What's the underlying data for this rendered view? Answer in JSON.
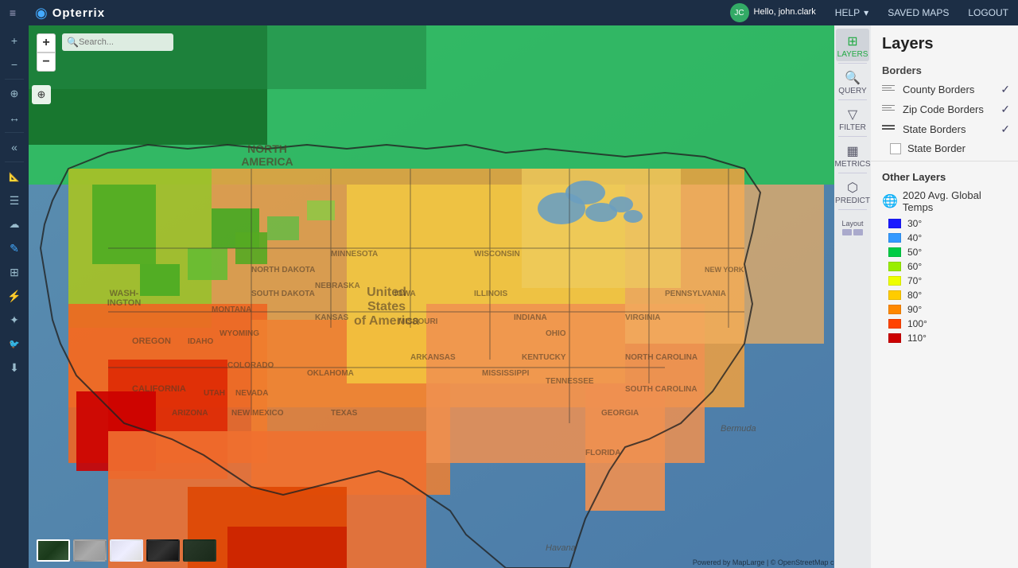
{
  "navbar": {
    "expand_icon": "≡",
    "logo_icon": "◉",
    "logo_text": "Opterrix",
    "user": {
      "initials": "JC",
      "greeting": "Hello, john.clark",
      "help_label": "HELP",
      "help_chevron": "▾",
      "saved_maps_label": "SAVED MAPS",
      "logout_label": "LOGOUT"
    }
  },
  "left_toolbar": {
    "buttons": [
      {
        "name": "zoom-in",
        "icon": "+",
        "active": false
      },
      {
        "name": "zoom-out",
        "icon": "−",
        "active": false
      },
      {
        "name": "identify",
        "icon": "⊕",
        "active": false
      },
      {
        "name": "pan",
        "icon": "↔",
        "active": false
      },
      {
        "name": "previous",
        "icon": "«",
        "active": false
      },
      {
        "name": "ruler",
        "icon": "📏",
        "active": false
      },
      {
        "name": "layers-list",
        "icon": "☰",
        "active": false
      },
      {
        "name": "draw",
        "icon": "✏",
        "active": false
      },
      {
        "name": "sun",
        "icon": "☀",
        "active": false
      },
      {
        "name": "pencil",
        "icon": "✎",
        "active": true
      },
      {
        "name": "grid",
        "icon": "⊞",
        "active": false
      },
      {
        "name": "lightning",
        "icon": "⚡",
        "active": false
      },
      {
        "name": "star",
        "icon": "✦",
        "active": false
      },
      {
        "name": "twitter",
        "icon": "🐦",
        "active": false
      },
      {
        "name": "download",
        "icon": "⬇",
        "active": false
      }
    ]
  },
  "map": {
    "search_placeholder": "Search...",
    "attribution": "Powered by MapLarge | © OpenStreetMap contributors"
  },
  "right_panel_toolbar": {
    "buttons": [
      {
        "name": "layers",
        "icon": "⊞",
        "label": "LAYERS",
        "active": true
      },
      {
        "name": "query",
        "icon": "🔍",
        "label": "QUERY",
        "active": false
      },
      {
        "name": "filter",
        "icon": "⊿",
        "label": "FILTER",
        "active": false
      },
      {
        "name": "metrics",
        "icon": "▦",
        "label": "METRICS",
        "active": false
      },
      {
        "name": "predict",
        "icon": "⬡",
        "label": "PREDICT",
        "active": false
      },
      {
        "name": "layout",
        "icon": "⧉",
        "label": "Layout",
        "active": false
      }
    ]
  },
  "layers_panel": {
    "title": "Layers",
    "borders_section": "Borders",
    "border_items": [
      {
        "name": "county-borders",
        "label": "County Borders",
        "checked": true
      },
      {
        "name": "zip-code-borders",
        "label": "Zip Code Borders",
        "checked": true
      },
      {
        "name": "state-borders",
        "label": "State Borders",
        "checked": true
      }
    ],
    "state_border_checkbox": {
      "label": "State Border",
      "checked": false
    },
    "other_layers_title": "Other Layers",
    "other_layer_name": "2020 Avg. Global Temps",
    "legend": [
      {
        "label": "30°",
        "color": "#1a1aff"
      },
      {
        "label": "40°",
        "color": "#3399ff"
      },
      {
        "label": "50°",
        "color": "#00cc44"
      },
      {
        "label": "60°",
        "color": "#99ee00"
      },
      {
        "label": "70°",
        "color": "#eeff00"
      },
      {
        "label": "80°",
        "color": "#ffcc00"
      },
      {
        "label": "90°",
        "color": "#ff8800"
      },
      {
        "label": "100°",
        "color": "#ff4400"
      },
      {
        "label": "110°",
        "color": "#cc0000"
      }
    ]
  },
  "map_thumbnails": [
    {
      "name": "satellite",
      "selected": true
    },
    {
      "name": "gray",
      "selected": false
    },
    {
      "name": "light",
      "selected": false
    },
    {
      "name": "dark",
      "selected": false
    },
    {
      "name": "topo",
      "selected": false
    }
  ]
}
